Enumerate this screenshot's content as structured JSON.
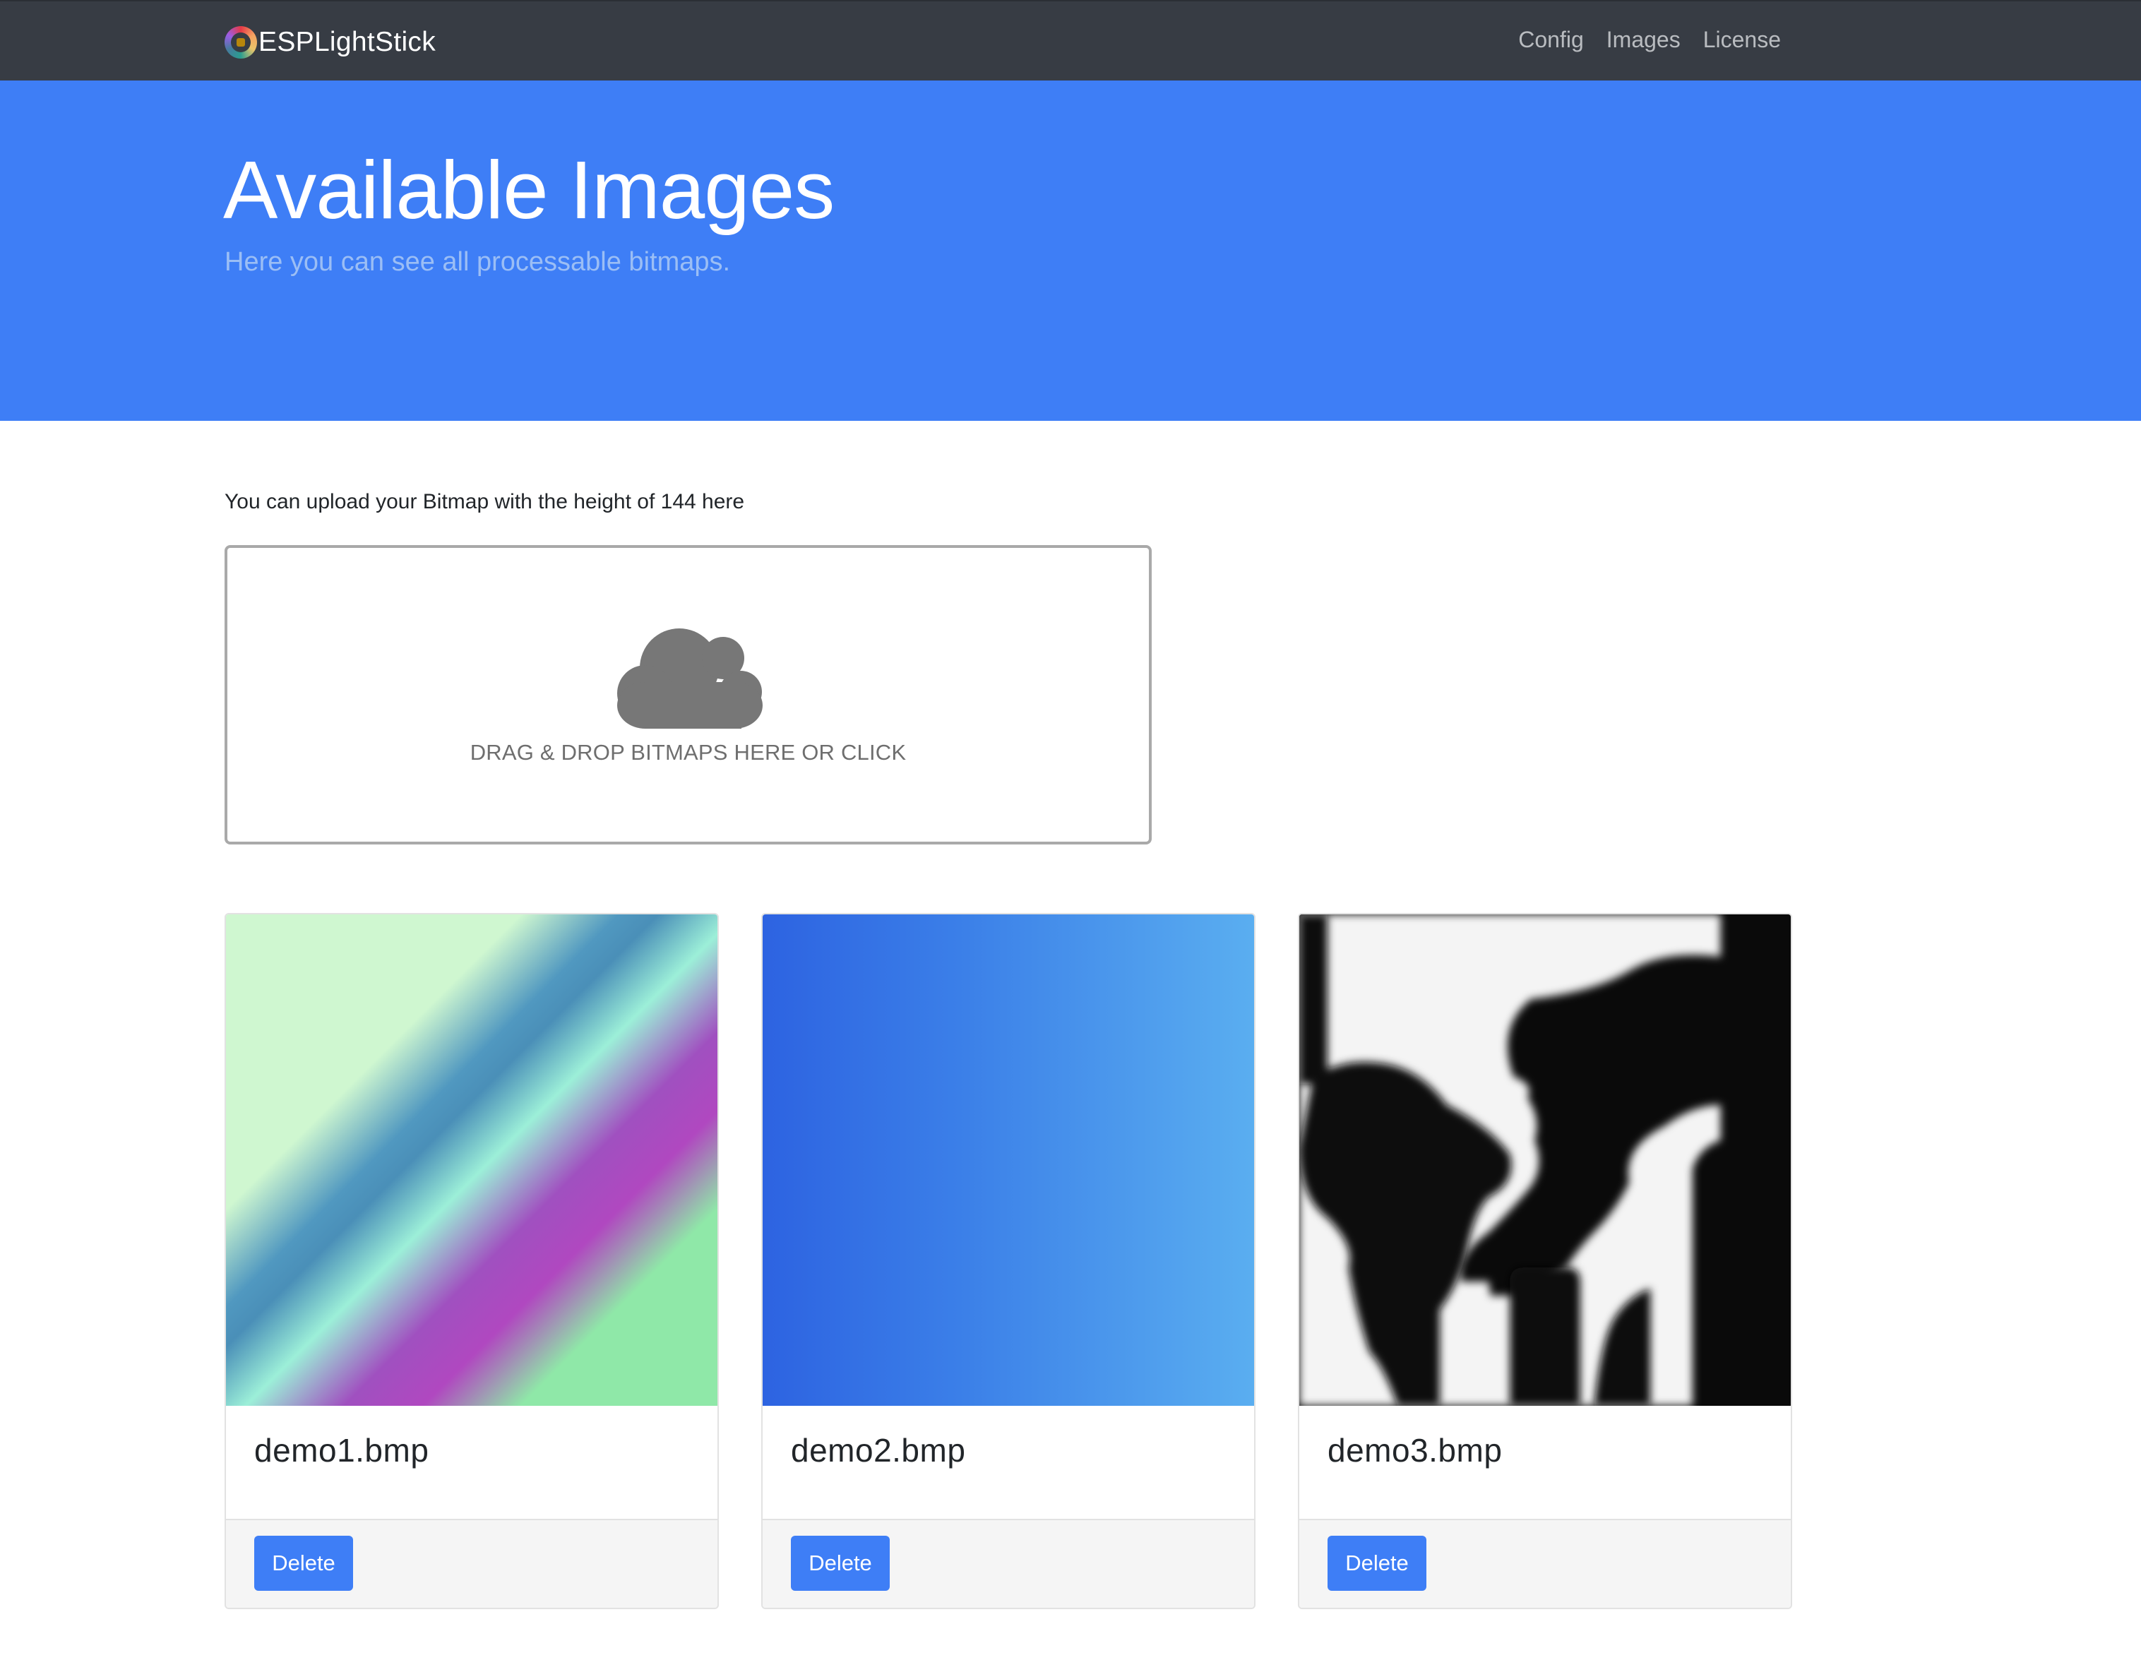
{
  "navbar": {
    "brand": "ESPLightStick",
    "links": [
      "Config",
      "Images",
      "License"
    ]
  },
  "hero": {
    "title": "Available Images",
    "subtitle": "Here you can see all processable bitmaps."
  },
  "upload": {
    "label": "You can upload your Bitmap with the height of 144 here",
    "dropzone_text": "DRAG & DROP BITMAPS HERE OR CLICK",
    "icon": "cloud-icon"
  },
  "images": [
    {
      "filename": "demo1.bmp",
      "delete_label": "Delete"
    },
    {
      "filename": "demo2.bmp",
      "delete_label": "Delete"
    },
    {
      "filename": "demo3.bmp",
      "delete_label": "Delete"
    }
  ],
  "colors": {
    "navbar": "#373c44",
    "hero": "#3e7ef6",
    "button": "#3e7ef6"
  }
}
